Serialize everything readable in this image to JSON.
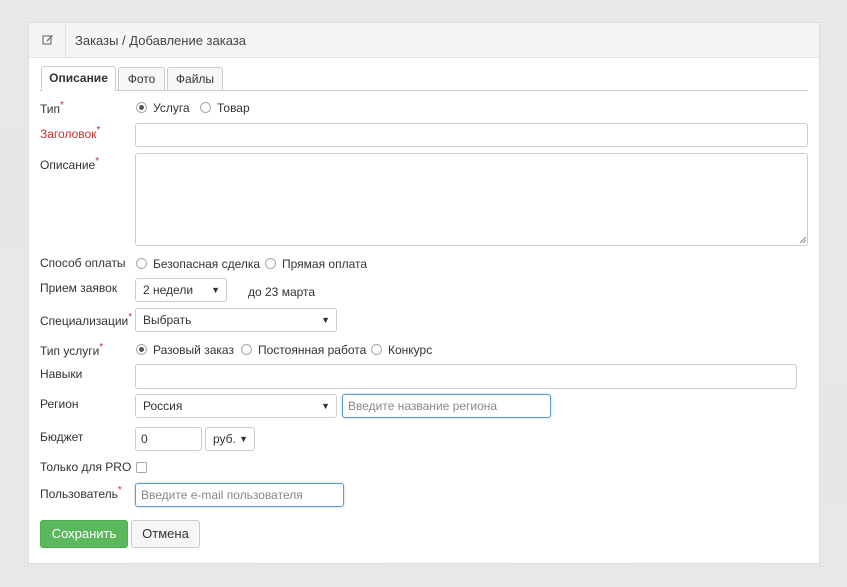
{
  "header": {
    "breadcrumb": "Заказы / Добавление заказа",
    "icon": "edit-icon"
  },
  "tabs": [
    {
      "label": "Описание",
      "active": true
    },
    {
      "label": "Фото",
      "active": false
    },
    {
      "label": "Файлы",
      "active": false
    }
  ],
  "form": {
    "type": {
      "label": "Тип",
      "required": "*",
      "options": [
        "Услуга",
        "Товар"
      ],
      "selected": "Услуга"
    },
    "title": {
      "label": "Заголовок",
      "required": "*",
      "value": ""
    },
    "description": {
      "label": "Описание",
      "required": "*",
      "value": ""
    },
    "payment": {
      "label": "Способ оплаты",
      "options": [
        "Безопасная сделка",
        "Прямая оплата"
      ],
      "selected": ""
    },
    "bids": {
      "label": "Прием заявок",
      "value": "2 недели",
      "until": "до 23 марта"
    },
    "specialization": {
      "label": "Специализации",
      "required": "*",
      "value": "Выбрать"
    },
    "service_type": {
      "label": "Тип услуги",
      "required": "*",
      "options": [
        "Разовый заказ",
        "Постоянная работа",
        "Конкурс"
      ],
      "selected": "Разовый заказ"
    },
    "skills": {
      "label": "Навыки",
      "value": ""
    },
    "region": {
      "label": "Регион",
      "country": "Россия",
      "placeholder": "Введите название региона"
    },
    "budget": {
      "label": "Бюджет",
      "value": "0",
      "currency": "руб."
    },
    "pro_only": {
      "label": "Только для PRO",
      "checked": false
    },
    "user": {
      "label": "Пользователь",
      "required": "*",
      "placeholder": "Введите e-mail пользователя"
    }
  },
  "actions": {
    "save_label": "Сохранить",
    "cancel_label": "Отмена"
  },
  "colors": {
    "accent_green": "#5cb85c",
    "required_red": "#c9302c",
    "focus_blue": "#5b9bd5"
  }
}
